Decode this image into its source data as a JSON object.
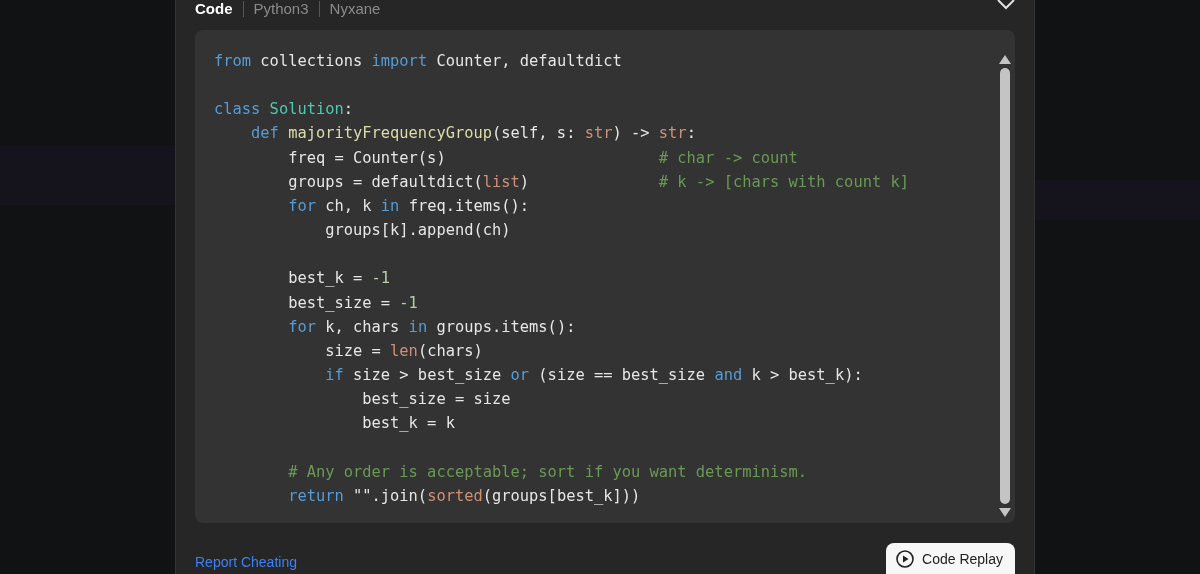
{
  "modal": {
    "tabs": [
      {
        "label": "Code",
        "selected": true
      },
      {
        "label": "Python3",
        "selected": false
      },
      {
        "label": "Nyxane",
        "selected": false
      }
    ],
    "code_lines": [
      {
        "tokens": [
          {
            "kind": "keyword",
            "text": "from"
          },
          {
            "kind": "plain",
            "text": " collections "
          },
          {
            "kind": "keyword",
            "text": "import"
          },
          {
            "kind": "plain",
            "text": " Counter, defaultdict"
          }
        ]
      },
      {
        "gap_before": true,
        "tokens": [
          {
            "kind": "keyword",
            "text": "class"
          },
          {
            "kind": "class",
            "text": " Solution"
          },
          {
            "kind": "plain",
            "text": ":"
          }
        ]
      },
      {
        "tokens": [
          {
            "kind": "keyword",
            "text": "    def"
          },
          {
            "kind": "function",
            "text": " majorityFrequencyGroup"
          },
          {
            "kind": "plain",
            "text": "(self, s: "
          },
          {
            "kind": "builtin",
            "text": "str"
          },
          {
            "kind": "plain",
            "text": ") -> "
          },
          {
            "kind": "builtin",
            "text": "str"
          },
          {
            "kind": "plain",
            "text": ":"
          }
        ]
      },
      {
        "tokens": [
          {
            "kind": "plain",
            "text": "        freq = Counter(s)                       "
          },
          {
            "kind": "comment",
            "text": "# char -> count"
          }
        ]
      },
      {
        "tokens": [
          {
            "kind": "plain",
            "text": "        groups = defaultdict("
          },
          {
            "kind": "builtin",
            "text": "list"
          },
          {
            "kind": "plain",
            "text": ")              "
          },
          {
            "kind": "comment",
            "text": "# k -> [chars with count k]"
          }
        ]
      },
      {
        "tokens": [
          {
            "kind": "keyword",
            "text": "        for"
          },
          {
            "kind": "plain",
            "text": " ch, k "
          },
          {
            "kind": "keyword",
            "text": "in"
          },
          {
            "kind": "plain",
            "text": " freq.items():"
          }
        ]
      },
      {
        "tokens": [
          {
            "kind": "plain",
            "text": "            groups[k].append(ch)"
          }
        ]
      },
      {
        "gap_before": true,
        "tokens": [
          {
            "kind": "plain",
            "text": "        best_k = "
          },
          {
            "kind": "number",
            "text": "-1"
          }
        ]
      },
      {
        "tokens": [
          {
            "kind": "plain",
            "text": "        best_size = "
          },
          {
            "kind": "number",
            "text": "-1"
          }
        ]
      },
      {
        "tokens": [
          {
            "kind": "keyword",
            "text": "        for"
          },
          {
            "kind": "plain",
            "text": " k, chars "
          },
          {
            "kind": "keyword",
            "text": "in"
          },
          {
            "kind": "plain",
            "text": " groups.items():"
          }
        ]
      },
      {
        "tokens": [
          {
            "kind": "plain",
            "text": "            size = "
          },
          {
            "kind": "builtin",
            "text": "len"
          },
          {
            "kind": "plain",
            "text": "(chars)"
          }
        ]
      },
      {
        "tokens": [
          {
            "kind": "keyword",
            "text": "            if"
          },
          {
            "kind": "plain",
            "text": " size > best_size "
          },
          {
            "kind": "keyword",
            "text": "or"
          },
          {
            "kind": "plain",
            "text": " (size == best_size "
          },
          {
            "kind": "keyword",
            "text": "and"
          },
          {
            "kind": "plain",
            "text": " k > best_k):"
          }
        ]
      },
      {
        "tokens": [
          {
            "kind": "plain",
            "text": "                best_size = size"
          }
        ]
      },
      {
        "tokens": [
          {
            "kind": "plain",
            "text": "                best_k = k"
          }
        ]
      },
      {
        "gap_before": true,
        "tokens": [
          {
            "kind": "comment",
            "text": "        # Any order is acceptable; sort if you want determinism."
          }
        ]
      },
      {
        "tokens": [
          {
            "kind": "keyword",
            "text": "        return"
          },
          {
            "kind": "plain",
            "text": " \"\".join("
          },
          {
            "kind": "builtin",
            "text": "sorted"
          },
          {
            "kind": "plain",
            "text": "(groups[best_k]))"
          }
        ]
      }
    ],
    "report_link": "Report Cheating",
    "replay_button": "Code Replay"
  }
}
